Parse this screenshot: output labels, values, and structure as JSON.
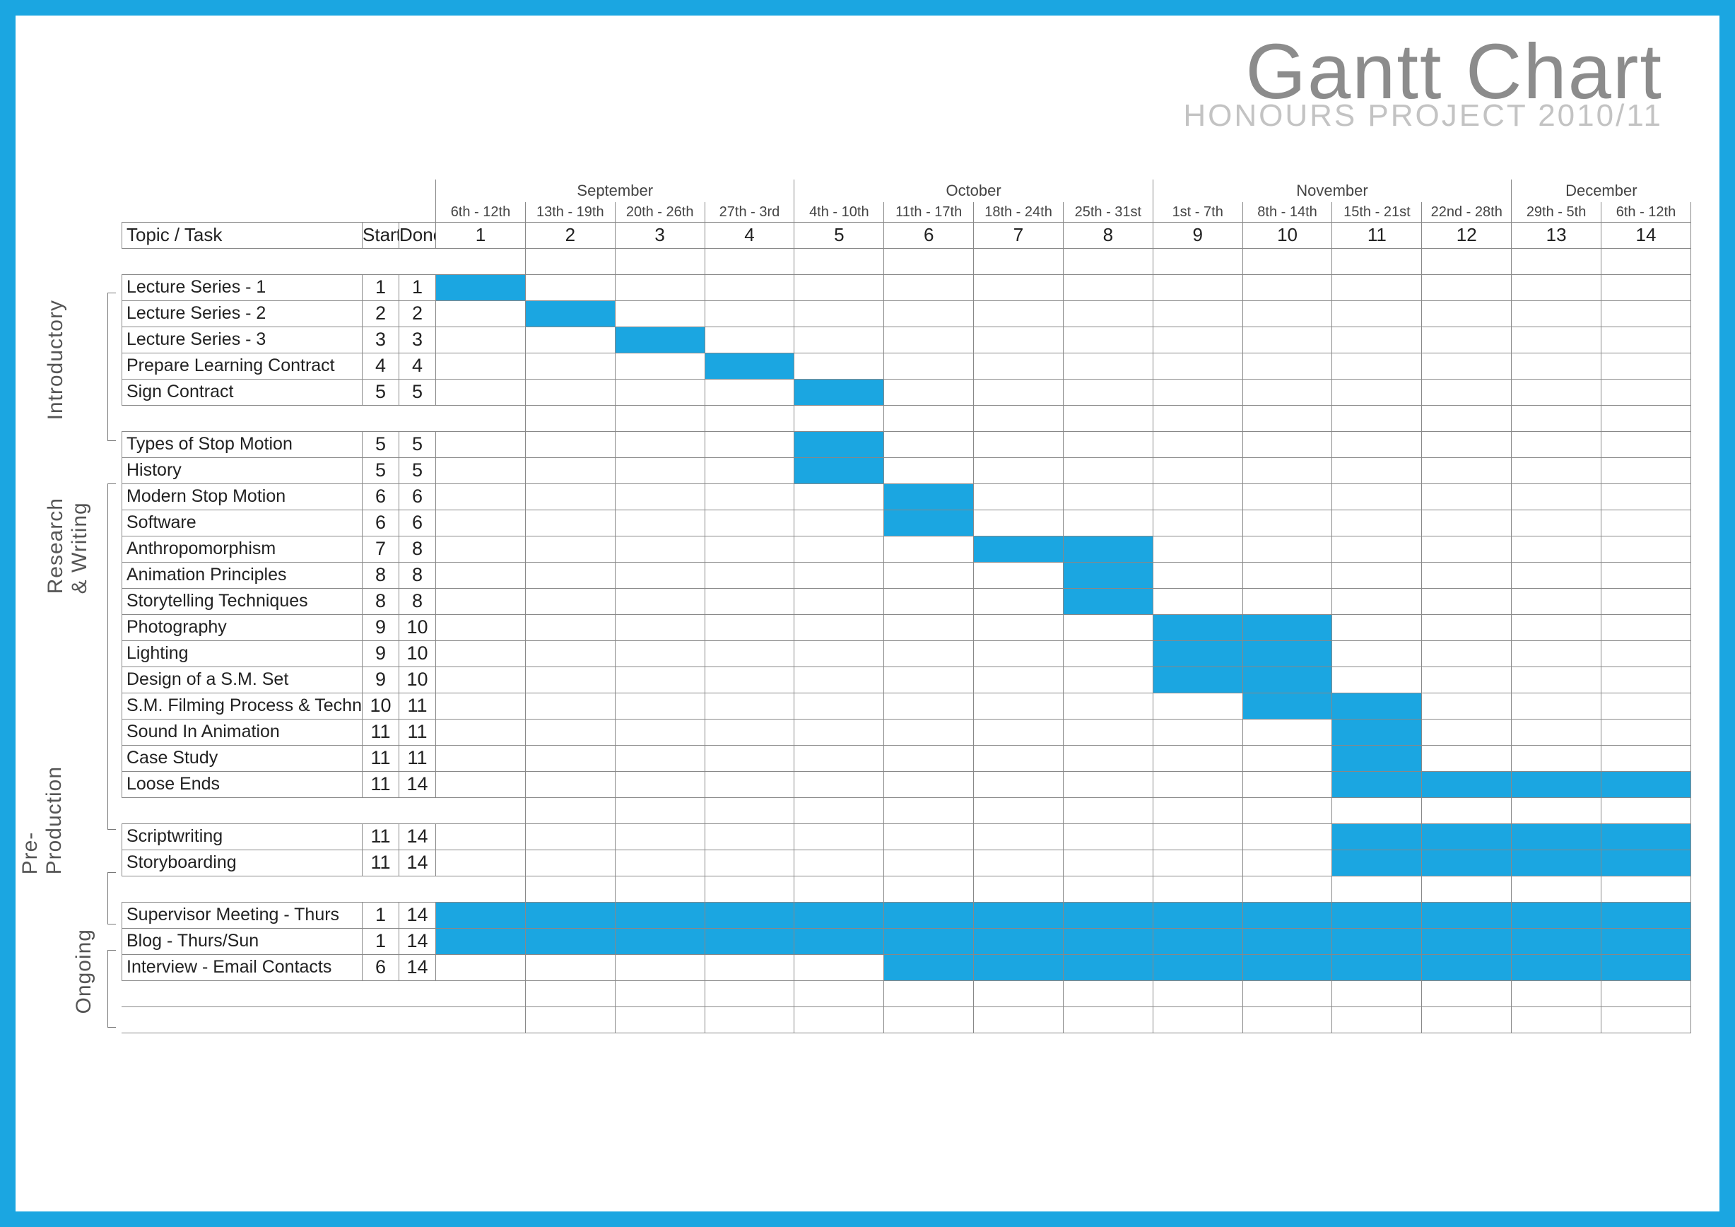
{
  "title": "Gantt Chart",
  "subtitle": "HONOURS PROJECT 2010/11",
  "header": {
    "task_label": "Topic / Task",
    "start_label": "Start",
    "done_label": "Done"
  },
  "months": [
    {
      "name": "September",
      "span": 4
    },
    {
      "name": "October",
      "span": 4
    },
    {
      "name": "November",
      "span": 4
    },
    {
      "name": "December",
      "span": 2
    }
  ],
  "date_ranges": [
    "6th - 12th",
    "13th - 19th",
    "20th - 26th",
    "27th - 3rd",
    "4th - 10th",
    "11th - 17th",
    "18th - 24th",
    "25th - 31st",
    "1st - 7th",
    "8th - 14th",
    "15th - 21st",
    "22nd - 28th",
    "29th - 5th",
    "6th - 12th"
  ],
  "week_numbers": [
    1,
    2,
    3,
    4,
    5,
    6,
    7,
    8,
    9,
    10,
    11,
    12,
    13,
    14
  ],
  "sections": [
    {
      "name": "Introductory",
      "key": "intro"
    },
    {
      "name": "Research & Writing",
      "key": "rw"
    },
    {
      "name": "Pre-Production",
      "key": "pp"
    },
    {
      "name": "Ongoing",
      "key": "og"
    }
  ],
  "chart_data": {
    "type": "gantt",
    "weeks": 14,
    "groups": [
      {
        "name": "Introductory",
        "tasks": [
          {
            "name": "Lecture Series - 1",
            "start": 1,
            "done": 1
          },
          {
            "name": "Lecture Series - 2",
            "start": 2,
            "done": 2
          },
          {
            "name": "Lecture Series - 3",
            "start": 3,
            "done": 3
          },
          {
            "name": "Prepare Learning Contract",
            "start": 4,
            "done": 4
          },
          {
            "name": "Sign Contract",
            "start": 5,
            "done": 5
          }
        ]
      },
      {
        "name": "Research & Writing",
        "tasks": [
          {
            "name": "Types of Stop Motion",
            "start": 5,
            "done": 5
          },
          {
            "name": "History",
            "start": 5,
            "done": 5
          },
          {
            "name": "Modern Stop Motion",
            "start": 6,
            "done": 6
          },
          {
            "name": "Software",
            "start": 6,
            "done": 6
          },
          {
            "name": "Anthropomorphism",
            "start": 7,
            "done": 8
          },
          {
            "name": "Animation Principles",
            "start": 8,
            "done": 8
          },
          {
            "name": "Storytelling Techniques",
            "start": 8,
            "done": 8
          },
          {
            "name": "Photography",
            "start": 9,
            "done": 10
          },
          {
            "name": "Lighting",
            "start": 9,
            "done": 10
          },
          {
            "name": "Design of a S.M. Set",
            "start": 9,
            "done": 10
          },
          {
            "name": "S.M. Filming Process & Techniques",
            "start": 10,
            "done": 11
          },
          {
            "name": "Sound In Animation",
            "start": 11,
            "done": 11
          },
          {
            "name": "Case Study",
            "start": 11,
            "done": 11
          },
          {
            "name": "Loose Ends",
            "start": 11,
            "done": 14
          }
        ]
      },
      {
        "name": "Pre-Production",
        "tasks": [
          {
            "name": "Scriptwriting",
            "start": 11,
            "done": 14
          },
          {
            "name": "Storyboarding",
            "start": 11,
            "done": 14
          }
        ]
      },
      {
        "name": "Ongoing",
        "tasks": [
          {
            "name": "Supervisor Meeting - Thurs",
            "start": 1,
            "done": 14
          },
          {
            "name": "Blog - Thurs/Sun",
            "start": 1,
            "done": 14
          },
          {
            "name": "Interview - Email Contacts",
            "start": 6,
            "done": 14
          }
        ]
      }
    ]
  }
}
